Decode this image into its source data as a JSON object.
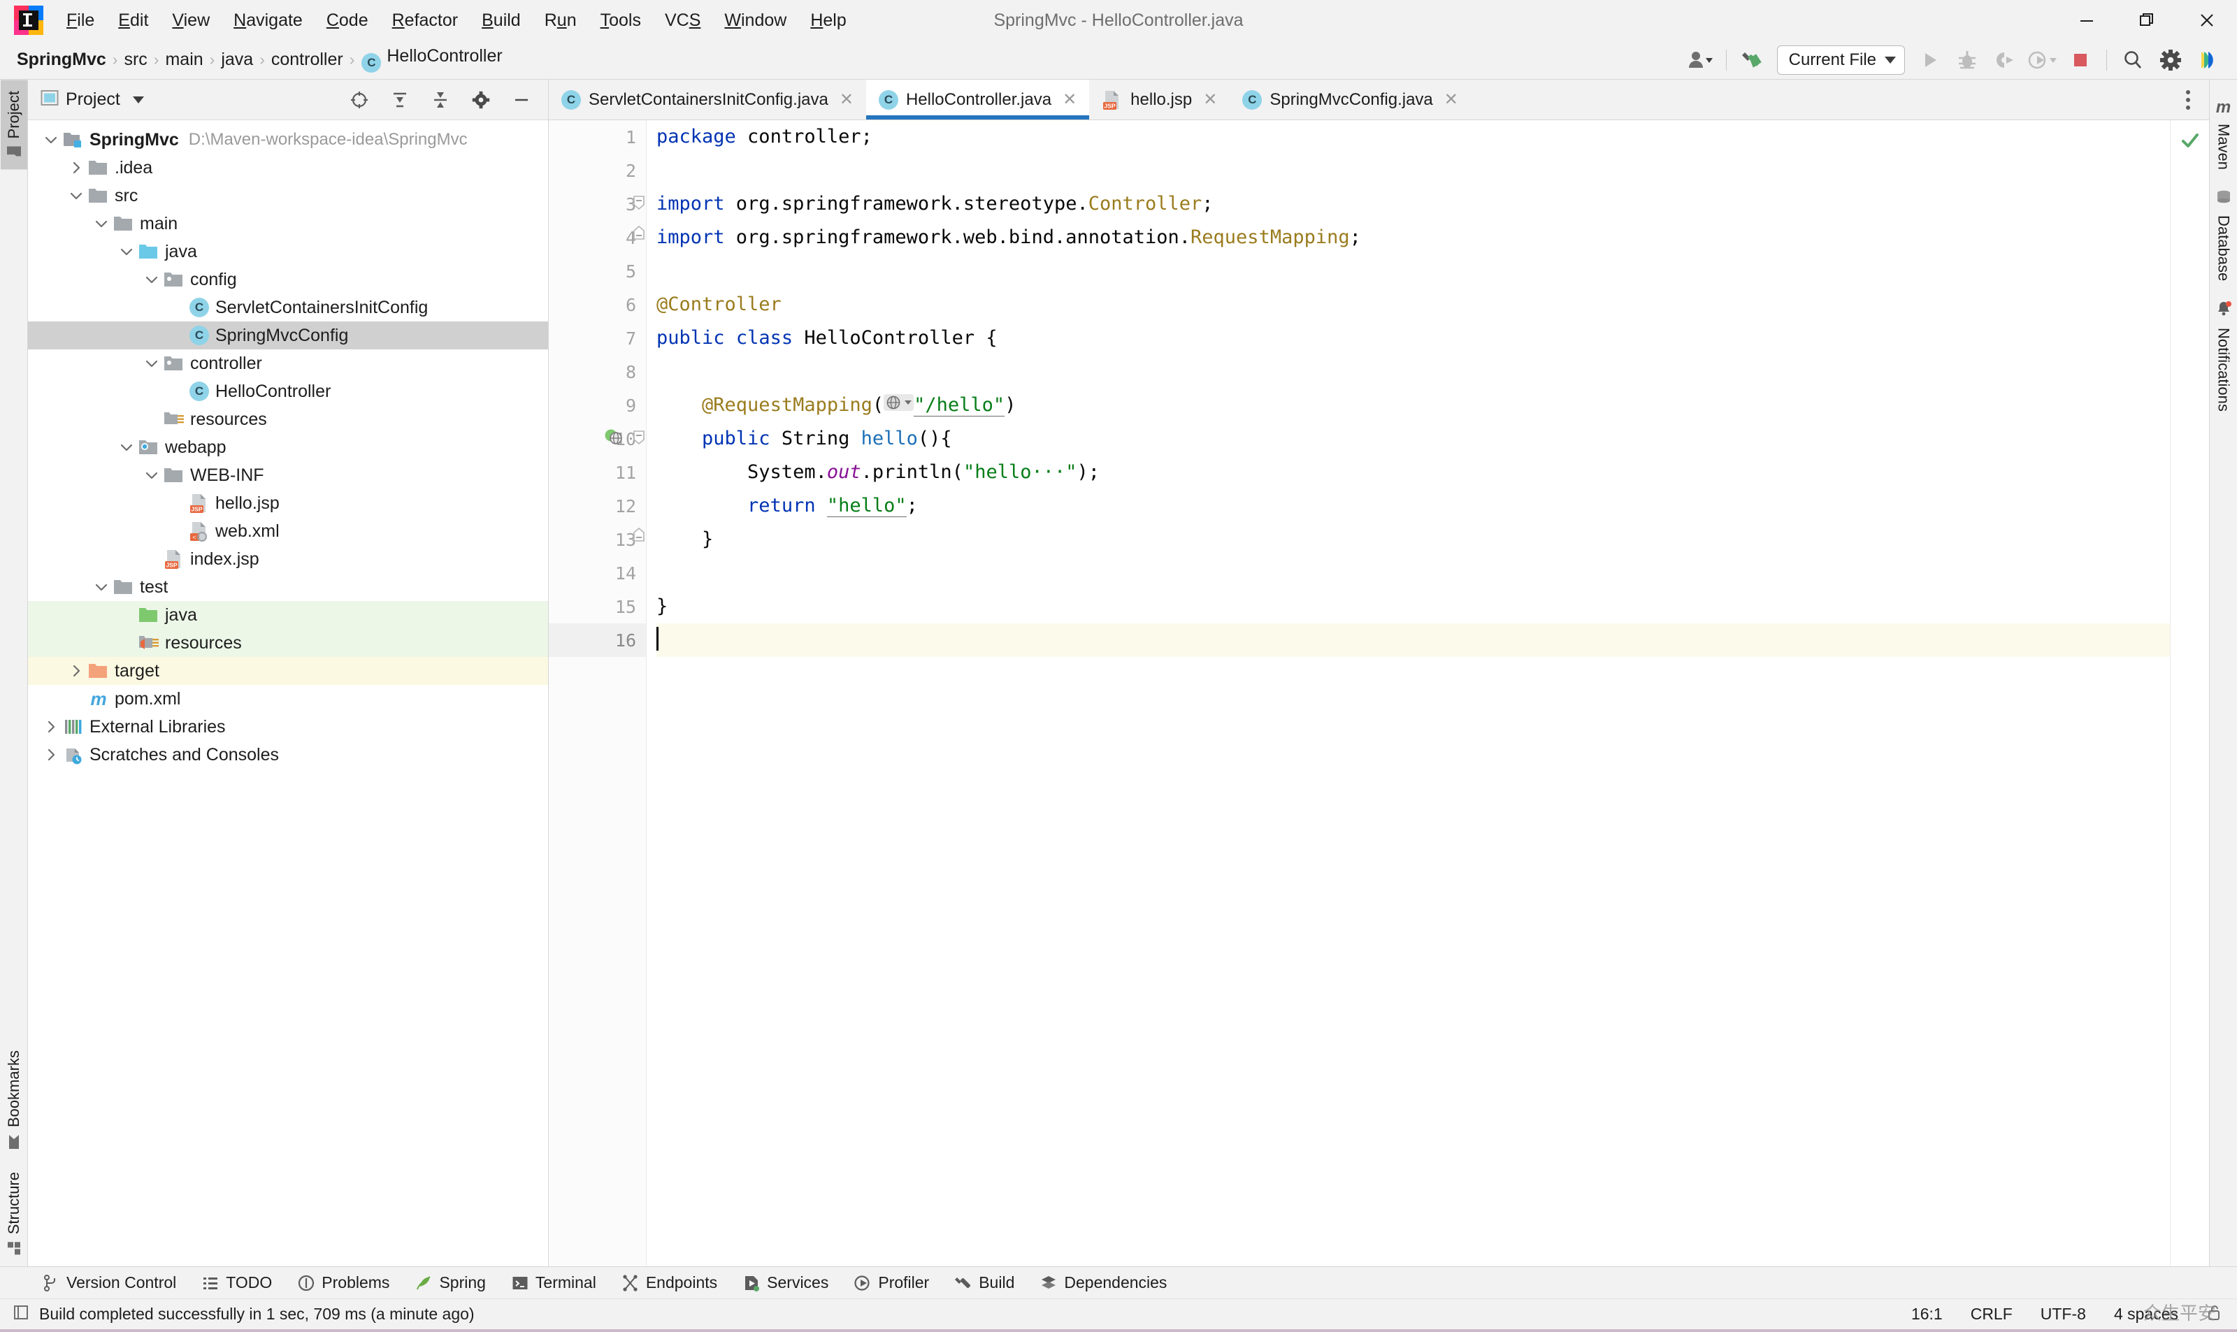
{
  "window": {
    "title": "SpringMvc - HelloController.java",
    "minimize_label": "Minimize",
    "restore_label": "Restore",
    "close_label": "Close"
  },
  "menubar": {
    "items": [
      {
        "label": "File",
        "mnemonic": "F"
      },
      {
        "label": "Edit",
        "mnemonic": "E"
      },
      {
        "label": "View",
        "mnemonic": "V"
      },
      {
        "label": "Navigate",
        "mnemonic": "N"
      },
      {
        "label": "Code",
        "mnemonic": "C"
      },
      {
        "label": "Refactor",
        "mnemonic": "R"
      },
      {
        "label": "Build",
        "mnemonic": "B"
      },
      {
        "label": "Run",
        "mnemonic": "u"
      },
      {
        "label": "Tools",
        "mnemonic": "T"
      },
      {
        "label": "VCS",
        "mnemonic": "S"
      },
      {
        "label": "Window",
        "mnemonic": "W"
      },
      {
        "label": "Help",
        "mnemonic": "H"
      }
    ]
  },
  "navbar": {
    "breadcrumbs": [
      {
        "label": "SpringMvc",
        "bold": true,
        "icon": ""
      },
      {
        "label": "src",
        "bold": false,
        "icon": ""
      },
      {
        "label": "main",
        "bold": false,
        "icon": ""
      },
      {
        "label": "java",
        "bold": false,
        "icon": ""
      },
      {
        "label": "controller",
        "bold": false,
        "icon": ""
      },
      {
        "label": "HelloController",
        "bold": false,
        "icon": "class-badge"
      }
    ],
    "separator": "›",
    "toolbar": {
      "account_icon": "user-icon",
      "updates_icon": "build-hammer-icon",
      "run_config": "Current File",
      "run_icon": "run-icon",
      "debug_icon": "debug-icon",
      "run_coverage_icon": "run-with-coverage-icon",
      "profiler_icon": "profiler-icon",
      "stop_icon": "stop-icon",
      "search_icon": "search-icon",
      "settings_icon": "gear-icon",
      "assistant_icon": "ai-assistant-icon"
    }
  },
  "left_strip": {
    "top": [
      {
        "label": "Project",
        "icon": "project-folder-icon",
        "active": true
      }
    ],
    "bottom": [
      {
        "label": "Bookmarks",
        "icon": "bookmark-icon",
        "active": false
      },
      {
        "label": "Structure",
        "icon": "structure-icon",
        "active": false
      }
    ]
  },
  "right_strip": {
    "items": [
      {
        "label": "Maven",
        "icon": "maven-m-icon"
      },
      {
        "label": "Database",
        "icon": "database-icon"
      },
      {
        "label": "Notifications",
        "icon": "bell-icon",
        "badge": true
      }
    ]
  },
  "project_panel": {
    "title": "Project",
    "title_caret": "chevron-down-icon",
    "actions": [
      {
        "name": "select-opened-file-icon"
      },
      {
        "name": "expand-all-icon"
      },
      {
        "name": "collapse-all-icon"
      },
      {
        "name": "gear-icon"
      },
      {
        "name": "hide-icon"
      }
    ],
    "tree": [
      {
        "label": "SpringMvc",
        "detail": "D:\\Maven-workspace-idea\\SpringMvc",
        "depth": 0,
        "twisty": "down",
        "icon": "module-folder-icon",
        "bold": true,
        "state": ""
      },
      {
        "label": ".idea",
        "detail": "",
        "depth": 1,
        "twisty": "right",
        "icon": "folder-icon",
        "bold": false,
        "state": ""
      },
      {
        "label": "src",
        "detail": "",
        "depth": 1,
        "twisty": "down",
        "icon": "folder-icon",
        "bold": false,
        "state": ""
      },
      {
        "label": "main",
        "detail": "",
        "depth": 2,
        "twisty": "down",
        "icon": "folder-icon",
        "bold": false,
        "state": ""
      },
      {
        "label": "java",
        "detail": "",
        "depth": 3,
        "twisty": "down",
        "icon": "source-root-icon",
        "bold": false,
        "state": ""
      },
      {
        "label": "config",
        "detail": "",
        "depth": 4,
        "twisty": "down",
        "icon": "package-icon",
        "bold": false,
        "state": ""
      },
      {
        "label": "ServletContainersInitConfig",
        "detail": "",
        "depth": 5,
        "twisty": "none",
        "icon": "class-icon",
        "bold": false,
        "state": ""
      },
      {
        "label": "SpringMvcConfig",
        "detail": "",
        "depth": 5,
        "twisty": "none",
        "icon": "class-icon",
        "bold": false,
        "state": "selected"
      },
      {
        "label": "controller",
        "detail": "",
        "depth": 4,
        "twisty": "down",
        "icon": "package-icon",
        "bold": false,
        "state": ""
      },
      {
        "label": "HelloController",
        "detail": "",
        "depth": 5,
        "twisty": "none",
        "icon": "class-icon",
        "bold": false,
        "state": ""
      },
      {
        "label": "resources",
        "detail": "",
        "depth": 4,
        "twisty": "none",
        "icon": "resource-root-icon",
        "bold": false,
        "state": ""
      },
      {
        "label": "webapp",
        "detail": "",
        "depth": 3,
        "twisty": "down",
        "icon": "web-root-icon",
        "bold": false,
        "state": ""
      },
      {
        "label": "WEB-INF",
        "detail": "",
        "depth": 4,
        "twisty": "down",
        "icon": "folder-icon",
        "bold": false,
        "state": ""
      },
      {
        "label": "hello.jsp",
        "detail": "",
        "depth": 5,
        "twisty": "none",
        "icon": "jsp-file-icon",
        "bold": false,
        "state": ""
      },
      {
        "label": "web.xml",
        "detail": "",
        "depth": 5,
        "twisty": "none",
        "icon": "xml-file-icon",
        "bold": false,
        "state": ""
      },
      {
        "label": "index.jsp",
        "detail": "",
        "depth": 4,
        "twisty": "none",
        "icon": "jsp-file-icon",
        "bold": false,
        "state": ""
      },
      {
        "label": "test",
        "detail": "",
        "depth": 2,
        "twisty": "down",
        "icon": "folder-icon",
        "bold": false,
        "state": ""
      },
      {
        "label": "java",
        "detail": "",
        "depth": 3,
        "twisty": "none",
        "icon": "test-source-root-icon",
        "bold": false,
        "state": "green"
      },
      {
        "label": "resources",
        "detail": "",
        "depth": 3,
        "twisty": "none",
        "icon": "test-resource-root-icon",
        "bold": false,
        "state": "green"
      },
      {
        "label": "target",
        "detail": "",
        "depth": 1,
        "twisty": "right",
        "icon": "excluded-folder-icon",
        "bold": false,
        "state": "yellow"
      },
      {
        "label": "pom.xml",
        "detail": "",
        "depth": 1,
        "twisty": "none",
        "icon": "maven-pom-icon",
        "bold": false,
        "state": ""
      },
      {
        "label": "External Libraries",
        "detail": "",
        "depth": 0,
        "twisty": "right",
        "icon": "libraries-icon",
        "bold": false,
        "state": ""
      },
      {
        "label": "Scratches and Consoles",
        "detail": "",
        "depth": 0,
        "twisty": "right",
        "icon": "scratches-icon",
        "bold": false,
        "state": ""
      }
    ]
  },
  "editor": {
    "tabs": [
      {
        "label": "ServletContainersInitConfig.java",
        "icon": "class-icon",
        "active": false,
        "close": "✕"
      },
      {
        "label": "HelloController.java",
        "icon": "class-icon",
        "active": true,
        "close": "✕"
      },
      {
        "label": "hello.jsp",
        "icon": "jsp-file-icon",
        "active": false,
        "close": "✕"
      },
      {
        "label": "SpringMvcConfig.java",
        "icon": "class-icon",
        "active": false,
        "close": "✕"
      }
    ],
    "tab_overflow_icon": "more-vertical-icon",
    "line_numbers": [
      1,
      2,
      3,
      4,
      5,
      6,
      7,
      8,
      9,
      10,
      11,
      12,
      13,
      14,
      15,
      16
    ],
    "current_line": 16,
    "inspection_status_icon": "inspections-ok-check-icon",
    "lines": [
      {
        "n": 1,
        "segments": [
          {
            "t": "package",
            "c": "kw"
          },
          {
            "t": " controller;",
            "c": ""
          }
        ]
      },
      {
        "n": 2,
        "segments": []
      },
      {
        "n": 3,
        "segments": [
          {
            "t": "import",
            "c": "kw"
          },
          {
            "t": " org.springframework.stereotype.",
            "c": ""
          },
          {
            "t": "Controller",
            "c": "ann"
          },
          {
            "t": ";",
            "c": ""
          }
        ],
        "fold": "start"
      },
      {
        "n": 4,
        "segments": [
          {
            "t": "import",
            "c": "kw"
          },
          {
            "t": " org.springframework.web.bind.annotation.",
            "c": ""
          },
          {
            "t": "RequestMapping",
            "c": "ann"
          },
          {
            "t": ";",
            "c": ""
          }
        ],
        "fold": "end"
      },
      {
        "n": 5,
        "segments": []
      },
      {
        "n": 6,
        "segments": [
          {
            "t": "@Controller",
            "c": "ann"
          }
        ]
      },
      {
        "n": 7,
        "segments": [
          {
            "t": "public",
            "c": "kw"
          },
          {
            "t": " ",
            "c": ""
          },
          {
            "t": "class",
            "c": "kw"
          },
          {
            "t": " HelloController {",
            "c": ""
          }
        ]
      },
      {
        "n": 8,
        "segments": []
      },
      {
        "n": 9,
        "segments": [
          {
            "t": "    ",
            "c": ""
          },
          {
            "t": "@RequestMapping",
            "c": "ann"
          },
          {
            "t": "(",
            "c": ""
          },
          {
            "t": "ICON",
            "c": "icon"
          },
          {
            "t": "\"/hello\"",
            "c": "str-u"
          },
          {
            "t": ")",
            "c": ""
          }
        ]
      },
      {
        "n": 10,
        "segments": [
          {
            "t": "    ",
            "c": ""
          },
          {
            "t": "public",
            "c": "kw"
          },
          {
            "t": " String ",
            "c": ""
          },
          {
            "t": "hello",
            "c": "mth"
          },
          {
            "t": "(){",
            "c": ""
          }
        ],
        "gutter_icon": "web-mapping-gutter-icon",
        "fold": "start"
      },
      {
        "n": 11,
        "segments": [
          {
            "t": "        System.",
            "c": ""
          },
          {
            "t": "out",
            "c": "fld"
          },
          {
            "t": ".println(",
            "c": ""
          },
          {
            "t": "\"hello···\"",
            "c": "str"
          },
          {
            "t": ");",
            "c": ""
          }
        ]
      },
      {
        "n": 12,
        "segments": [
          {
            "t": "        ",
            "c": ""
          },
          {
            "t": "return",
            "c": "kw"
          },
          {
            "t": " ",
            "c": ""
          },
          {
            "t": "\"hello\"",
            "c": "str-u"
          },
          {
            "t": ";",
            "c": ""
          }
        ]
      },
      {
        "n": 13,
        "segments": [
          {
            "t": "    }",
            "c": ""
          }
        ],
        "fold": "end"
      },
      {
        "n": 14,
        "segments": []
      },
      {
        "n": 15,
        "segments": [
          {
            "t": "}",
            "c": ""
          }
        ]
      },
      {
        "n": 16,
        "segments": [],
        "caret": true
      }
    ]
  },
  "tool_window_bar": {
    "items": [
      {
        "label": "Version Control",
        "icon": "branch-icon"
      },
      {
        "label": "TODO",
        "icon": "todo-list-icon"
      },
      {
        "label": "Problems",
        "icon": "problems-icon"
      },
      {
        "label": "Spring",
        "icon": "spring-leaf-icon"
      },
      {
        "label": "Terminal",
        "icon": "terminal-icon"
      },
      {
        "label": "Endpoints",
        "icon": "endpoints-icon"
      },
      {
        "label": "Services",
        "icon": "services-icon"
      },
      {
        "label": "Profiler",
        "icon": "profiler-icon"
      },
      {
        "label": "Build",
        "icon": "build-hammer-icon"
      },
      {
        "label": "Dependencies",
        "icon": "dependencies-icon"
      }
    ]
  },
  "status_bar": {
    "message_icon": "build-status-icon",
    "message": "Build completed successfully in 1 sec, 709 ms (a minute ago)",
    "caret_position": "16:1",
    "line_separator": "CRLF",
    "encoding": "UTF-8",
    "indent": "4 spaces",
    "lock_icon": "lock-open-icon",
    "watermark": "众生平安"
  },
  "colors": {
    "accent_blue": "#2675bf",
    "keyword": "#0033b3",
    "annotation": "#9a7c1e",
    "string": "#067d17",
    "field": "#871094",
    "method": "#1c6fb6",
    "selection_gray": "#d0d0d0",
    "test_source_green": "#edf7e8",
    "excluded_yellow": "#fcf9e2",
    "current_line": "#fcfaeb",
    "stop_red": "#d8595e",
    "success_green": "#59a869"
  }
}
